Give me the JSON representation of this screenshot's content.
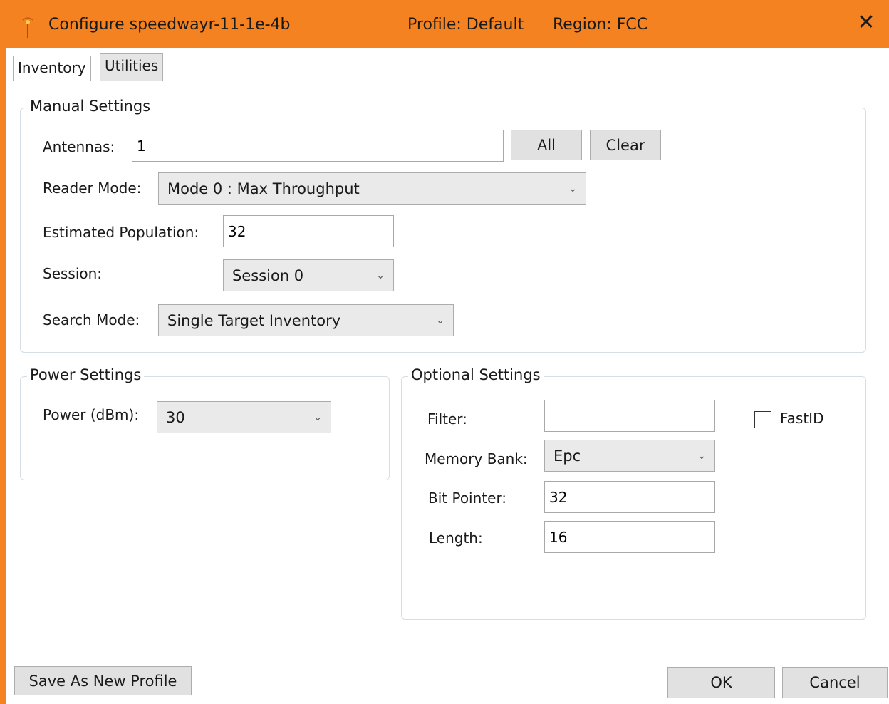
{
  "window": {
    "title": "Configure speedwayr-11-1e-4b",
    "profile": "Profile: Default",
    "region": "Region: FCC",
    "close_glyph": "✕",
    "app_icon": "antenna-icon",
    "accent_color": "#f58220"
  },
  "tabs": [
    {
      "label": "Inventory",
      "active": true
    },
    {
      "label": "Utilities",
      "active": false
    }
  ],
  "manual": {
    "legend": "Manual Settings",
    "antennas_label": "Antennas:",
    "antennas_value": "1",
    "all_button": "All",
    "clear_button": "Clear",
    "reader_mode_label": "Reader Mode:",
    "reader_mode_value": "Mode 0 : Max Throughput",
    "population_label": "Estimated Population:",
    "population_value": "32",
    "session_label": "Session:",
    "session_value": "Session 0",
    "search_mode_label": "Search Mode:",
    "search_mode_value": "Single Target Inventory"
  },
  "power": {
    "legend": "Power Settings",
    "power_label": "Power (dBm):",
    "power_value": "30"
  },
  "optional": {
    "legend": "Optional Settings",
    "filter_label": "Filter:",
    "filter_value": "",
    "fastid_label": "FastID",
    "fastid_checked": false,
    "memory_bank_label": "Memory Bank:",
    "memory_bank_value": "Epc",
    "bit_pointer_label": "Bit Pointer:",
    "bit_pointer_value": "32",
    "length_label": "Length:",
    "length_value": "16"
  },
  "footer": {
    "save_profile": "Save As New Profile",
    "ok": "OK",
    "cancel": "Cancel"
  },
  "caret_glyph": "⌄"
}
